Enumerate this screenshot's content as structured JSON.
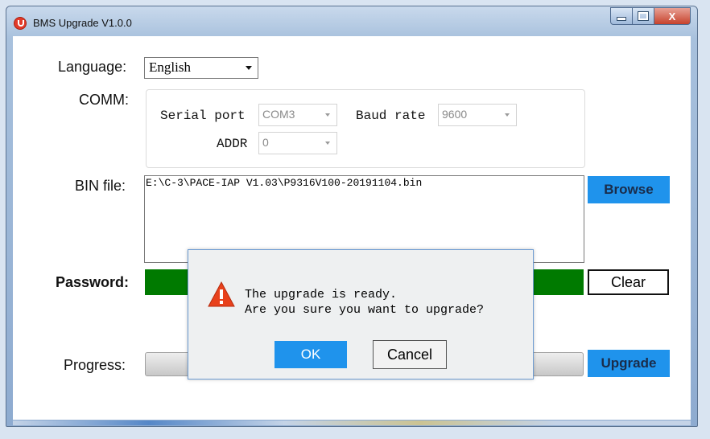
{
  "window": {
    "title": "BMS Upgrade V1.0.0",
    "controls": {
      "minimize": "▁",
      "maximize": "□",
      "close": "X"
    }
  },
  "language": {
    "label": "Language:",
    "value": "English"
  },
  "comm": {
    "label": "COMM:",
    "serial_port_label": "Serial port",
    "serial_port_value": "COM3",
    "baud_rate_label": "Baud rate",
    "baud_rate_value": "9600",
    "addr_label": "ADDR",
    "addr_value": "0"
  },
  "bin": {
    "label": "BIN file:",
    "path": "E:\\C-3\\PACE-IAP V1.03\\P9316V100-20191104.bin",
    "browse_label": "Browse"
  },
  "password": {
    "label": "Password:",
    "clear_label": "Clear"
  },
  "progress": {
    "label": "Progress:",
    "upgrade_label": "Upgrade",
    "value": 0
  },
  "dialog": {
    "message_line1": "The upgrade is ready.",
    "message_line2": "Are you sure you want to upgrade?",
    "ok_label": "OK",
    "cancel_label": "Cancel"
  },
  "colors": {
    "accent_blue": "#1f93ec",
    "password_green": "#007a00",
    "warning_red": "#e8411c"
  }
}
